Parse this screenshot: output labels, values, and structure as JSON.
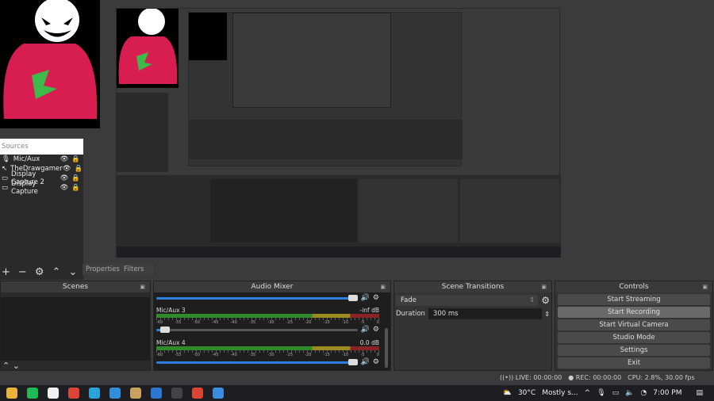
{
  "sources": {
    "title": "Sources",
    "items": [
      {
        "name": "Mic/Aux",
        "icon": "microphone-icon"
      },
      {
        "name": "TheDrawgamer",
        "icon": "cursor-icon"
      },
      {
        "name": "Display Capture 2",
        "icon": "monitor-icon"
      },
      {
        "name": "Display Capture",
        "icon": "monitor-icon"
      }
    ]
  },
  "tabs": {
    "properties": "Properties",
    "filters": "Filters"
  },
  "scenes": {
    "title": "Scenes"
  },
  "mixer": {
    "title": "Audio Mixer",
    "channels": [
      {
        "name": "Mic/Aux 3",
        "db": "-inf dB",
        "volume": 0.02
      },
      {
        "name": "Mic/Aux 4",
        "db": "0.0 dB",
        "volume": 1.0
      }
    ],
    "ticks": [
      "-60",
      "-55",
      "-50",
      "-45",
      "-40",
      "-35",
      "-30",
      "-25",
      "-20",
      "-15",
      "-10",
      "-5",
      "0"
    ]
  },
  "transitions": {
    "title": "Scene Transitions",
    "selected": "Fade",
    "duration_label": "Duration",
    "duration": "300 ms"
  },
  "controls": {
    "title": "Controls",
    "buttons": [
      "Start Streaming",
      "Start Recording",
      "Start Virtual Camera",
      "Studio Mode",
      "Settings",
      "Exit"
    ]
  },
  "status": {
    "live": "LIVE: 00:00:00",
    "rec": "REC: 00:00:00",
    "cpu": "CPU: 2.8%, 30.00 fps"
  },
  "taskbar": {
    "weather": "30°C",
    "weather_text": "Mostly s...",
    "time": "7:00 PM",
    "apps": [
      {
        "name": "file-explorer",
        "color": "#e8b43a"
      },
      {
        "name": "spotify",
        "color": "#1db954"
      },
      {
        "name": "store",
        "color": "#f0f0f0"
      },
      {
        "name": "chrome",
        "color": "#db4437"
      },
      {
        "name": "telegram",
        "color": "#2aa3dc"
      },
      {
        "name": "edge",
        "color": "#2f8fd8"
      },
      {
        "name": "paint",
        "color": "#c8a060"
      },
      {
        "name": "photos",
        "color": "#2a78d0"
      },
      {
        "name": "obs",
        "color": "#444444"
      },
      {
        "name": "chrome-2",
        "color": "#db4437"
      },
      {
        "name": "mail",
        "color": "#3a8ee0"
      }
    ]
  },
  "colors": {
    "accent": "#2f7fe0",
    "hoodie": "#d81e50"
  }
}
